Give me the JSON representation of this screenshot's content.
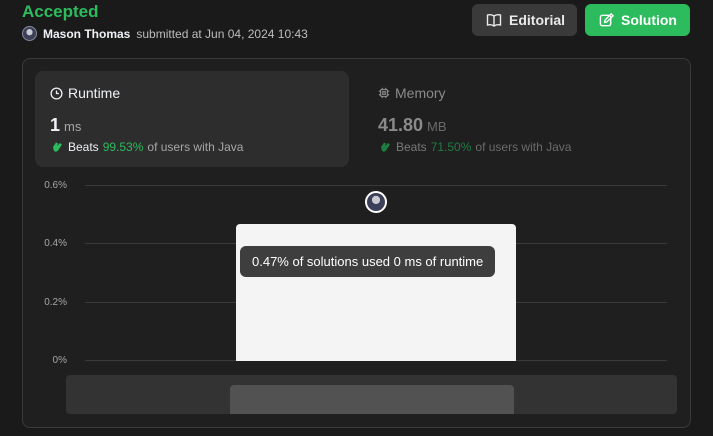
{
  "submission": {
    "status": "Accepted",
    "author": "Mason Thomas",
    "submitted_at": "submitted at Jun 04, 2024 10:43"
  },
  "actions": {
    "editorial_label": "Editorial",
    "solution_label": "Solution"
  },
  "runtime": {
    "title": "Runtime",
    "value": "1",
    "unit": "ms",
    "beats_label": "Beats",
    "beats_pct": "99.53%",
    "beats_suffix": "of users with Java",
    "icon": "clock-icon"
  },
  "memory": {
    "title": "Memory",
    "value": "41.80",
    "unit": "MB",
    "beats_label": "Beats",
    "beats_pct": "71.50%",
    "beats_suffix": "of users with Java",
    "icon": "chip-icon"
  },
  "chart": {
    "tooltip": "0.47% of solutions used 0 ms of runtime",
    "y_ticks": [
      "0.6%",
      "0.4%",
      "0.2%",
      "0%"
    ]
  },
  "colors": {
    "accent_green": "#2cbb5d",
    "background": "#1a1a1a",
    "card": "#2d2d2d"
  },
  "chart_data": {
    "type": "bar",
    "categories": [
      "0 ms"
    ],
    "values": [
      0.47
    ],
    "xlabel": "",
    "ylabel": "",
    "ylim": [
      0,
      0.6
    ],
    "yticks": [
      "0%",
      "0.2%",
      "0.4%",
      "0.6%"
    ],
    "grid": true
  }
}
